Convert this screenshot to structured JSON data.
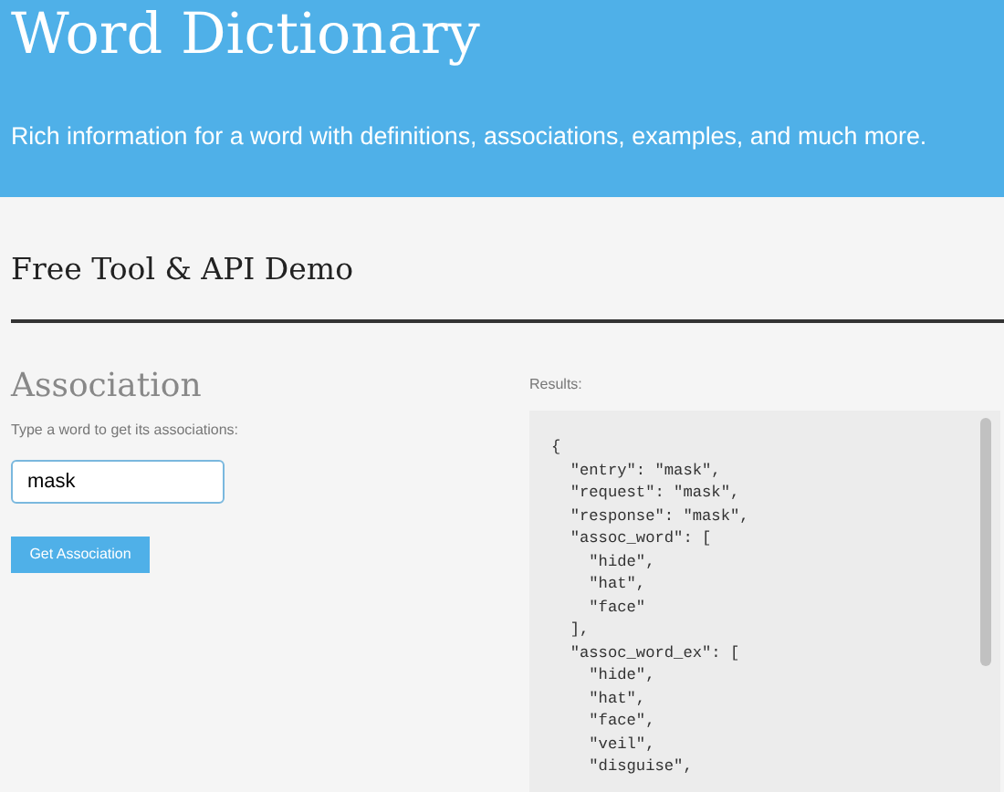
{
  "header": {
    "title": "Word Dictionary",
    "subtitle": "Rich information for a word with definitions, associations, examples, and much more."
  },
  "section_title": "Free Tool & API Demo",
  "form": {
    "heading": "Association",
    "hint": "Type a word to get its associations:",
    "input_value": "mask",
    "button": "Get Association"
  },
  "results": {
    "label": "Results:",
    "lines": [
      "{",
      "  \"entry\": \"mask\",",
      "  \"request\": \"mask\",",
      "  \"response\": \"mask\",",
      "  \"assoc_word\": [",
      "    \"hide\",",
      "    \"hat\",",
      "    \"face\"",
      "  ],",
      "  \"assoc_word_ex\": [",
      "    \"hide\",",
      "    \"hat\",",
      "    \"face\",",
      "    \"veil\",",
      "    \"disguise\","
    ]
  }
}
